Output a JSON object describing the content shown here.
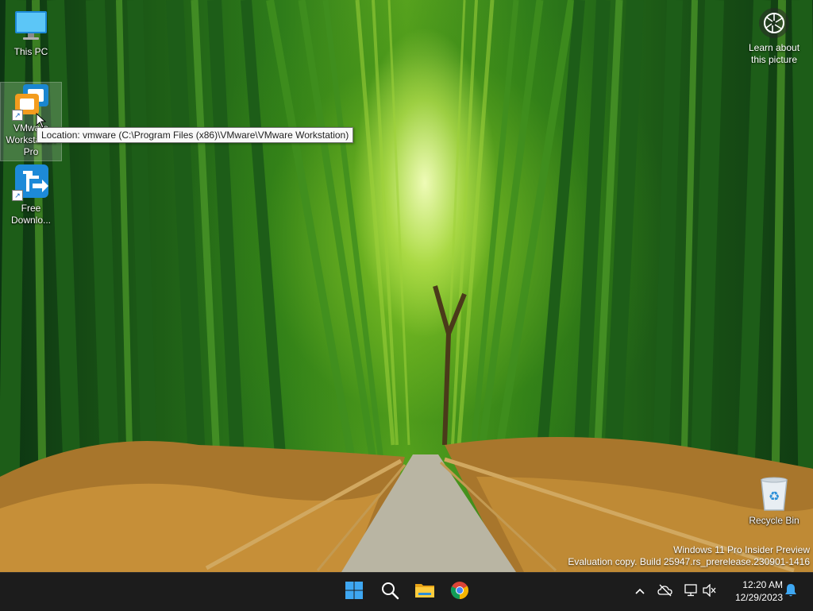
{
  "desktop": {
    "icons": [
      {
        "label": "This PC"
      },
      {
        "label": "VMware Workstation Pro"
      },
      {
        "label": "Free Downlo..."
      },
      {
        "label": "Recycle Bin"
      }
    ],
    "tooltip": "Location: vmware (C:\\Program Files (x86)\\VMware\\VMware Workstation)",
    "learn_label": "Learn about this picture",
    "watermark": {
      "line1": "Windows 11 Pro Insider Preview",
      "line2": "Evaluation copy. Build 25947.rs_prerelease.230901-1416"
    }
  },
  "taskbar": {
    "apps": [
      {
        "icon": "windows-start-icon"
      },
      {
        "icon": "search-icon"
      },
      {
        "icon": "file-explorer-icon"
      },
      {
        "icon": "chrome-icon"
      }
    ],
    "tray": {
      "icons": [
        "chevron-up-icon",
        "onedrive-offline-icon",
        "network-icon",
        "volume-muted-icon"
      ],
      "time": "12:20 AM",
      "date": "12/29/2023",
      "notification_icon": "bell-icon"
    }
  },
  "colors": {
    "taskbar_bg": "#1c1c1c",
    "accent": "#3ea7f2"
  }
}
